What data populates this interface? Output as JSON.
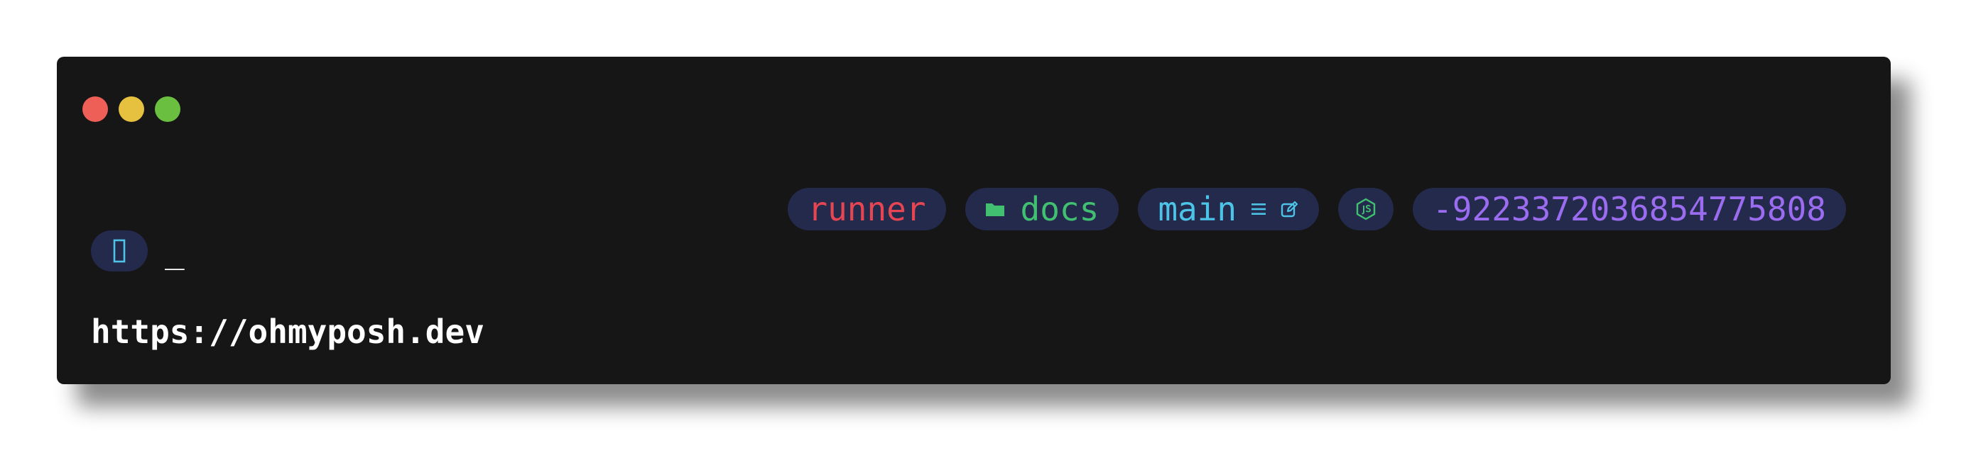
{
  "window": {
    "controls": [
      {
        "name": "close",
        "color": "#ee5f57"
      },
      {
        "name": "minimize",
        "color": "#e6c03f"
      },
      {
        "name": "maximize",
        "color": "#6abf40"
      }
    ],
    "background": "#161616"
  },
  "prompt": {
    "segment_bg": "#232a4c",
    "segments": {
      "user": {
        "text": "runner",
        "color": "#e64553"
      },
      "path": {
        "icon": "folder-icon",
        "text": "docs",
        "color": "#40c070"
      },
      "git": {
        "branch": "main",
        "status_icons": [
          "branch-equal-icon",
          "edit-icon"
        ],
        "color": "#4ec3e8"
      },
      "node": {
        "icon": "nodejs-icon",
        "color": "#40c070"
      },
      "exit": {
        "text": "-9223372036854775808",
        "color": "#9b6cf0"
      }
    },
    "left": {
      "icon": "bracket-icon",
      "color": "#4ec3e8"
    },
    "cursor": "_"
  },
  "footer": {
    "url": "https://ohmyposh.dev"
  }
}
